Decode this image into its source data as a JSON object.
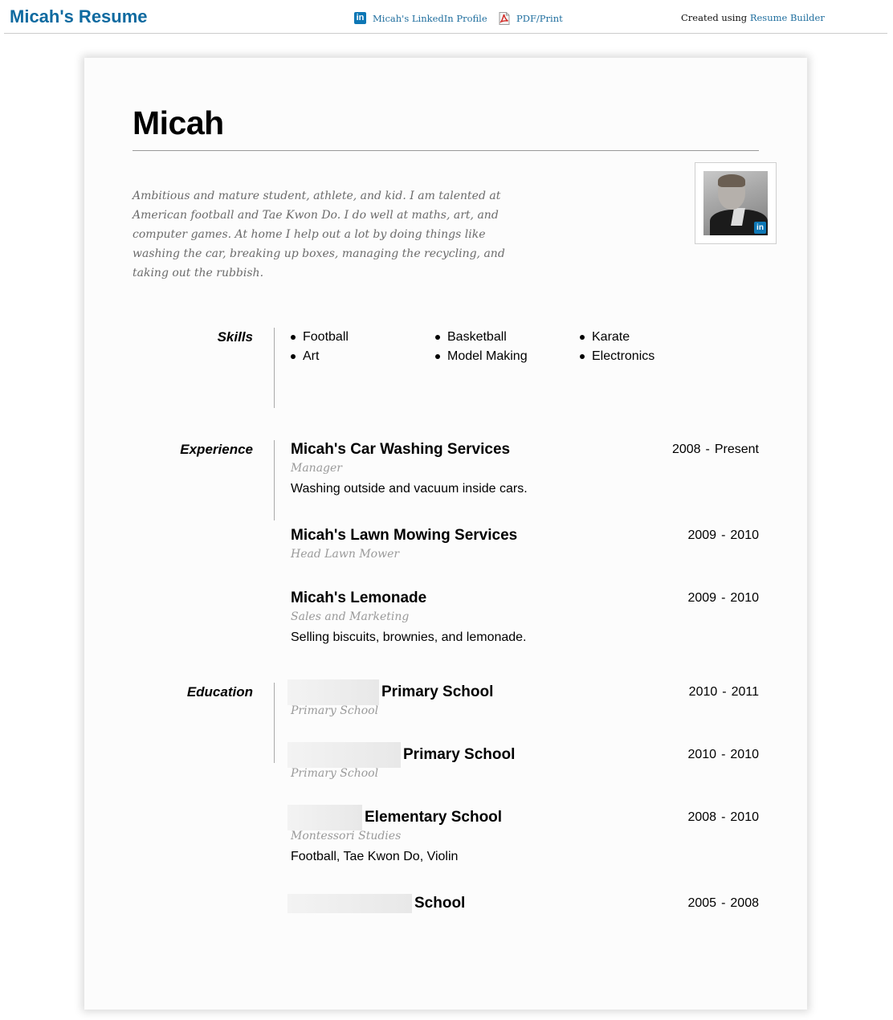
{
  "topbar": {
    "site_title": "Micah's Resume",
    "linkedin_link": "Micah's LinkedIn Profile",
    "linkedin_icon": "linkedin-icon",
    "pdf_link": "PDF/Print",
    "pdf_icon": "pdf-icon",
    "created_prefix": "Created using",
    "created_link": "Resume Builder"
  },
  "resume": {
    "name": "Micah",
    "summary": "Ambitious and mature student, athlete, and kid. I am talented at American football and Tae Kwon Do. I do well at maths, art, and computer games. At home I help out a lot by doing things like washing the car, breaking up boxes, managing the recycling, and taking out the rubbish.",
    "photo_badge": "in",
    "skills": {
      "label": "Skills",
      "items": [
        "Football",
        "Basketball",
        "Karate",
        "Art",
        "Model Making",
        "Electronics"
      ]
    },
    "experience": {
      "label": "Experience",
      "items": [
        {
          "org": "Micah's Car Washing Services",
          "role": "Manager",
          "start": "2008",
          "end": "Present",
          "desc": "Washing outside and vacuum inside cars."
        },
        {
          "org": "Micah's Lawn Mowing Services",
          "role": "Head Lawn Mower",
          "start": "2009",
          "end": "2010",
          "desc": ""
        },
        {
          "org": "Micah's Lemonade",
          "role": "Sales and Marketing",
          "start": "2009",
          "end": "2010",
          "desc": "Selling biscuits, brownies, and lemonade."
        }
      ]
    },
    "education": {
      "label": "Education",
      "items": [
        {
          "org": "Primary School",
          "role": "Primary School",
          "start": "2010",
          "end": "2011",
          "desc": ""
        },
        {
          "org": "Primary School",
          "role": "Primary School",
          "start": "2010",
          "end": "2010",
          "desc": ""
        },
        {
          "org": "Elementary School",
          "role": "Montessori Studies",
          "start": "2008",
          "end": "2010",
          "desc": "Football, Tae Kwon Do, Violin"
        },
        {
          "org": "School",
          "role": "",
          "start": "2005",
          "end": "2008",
          "desc": ""
        }
      ]
    },
    "date_separator": "-"
  }
}
